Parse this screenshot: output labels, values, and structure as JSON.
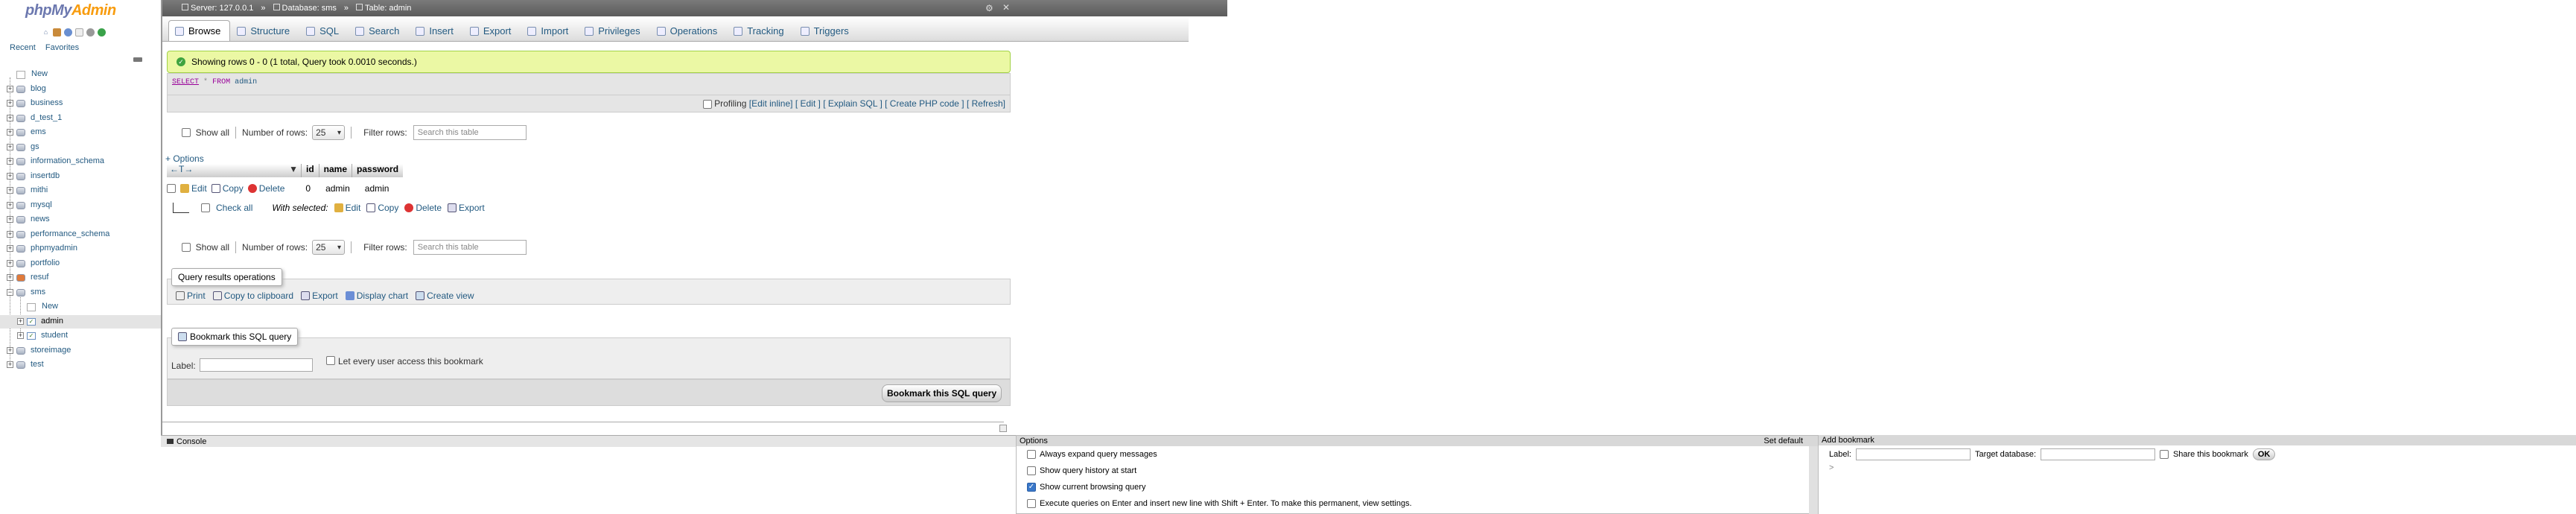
{
  "logo": {
    "php": "php",
    "my": "My",
    "admin": "Admin"
  },
  "nav": {
    "recent": "Recent",
    "favorites": "Favorites"
  },
  "tree": [
    {
      "label": "New",
      "kind": "new",
      "level": 0
    },
    {
      "label": "blog",
      "kind": "db",
      "level": 0
    },
    {
      "label": "business",
      "kind": "db",
      "level": 0
    },
    {
      "label": "d_test_1",
      "kind": "db",
      "level": 0
    },
    {
      "label": "ems",
      "kind": "db",
      "level": 0
    },
    {
      "label": "gs",
      "kind": "db",
      "level": 0
    },
    {
      "label": "information_schema",
      "kind": "db",
      "level": 0
    },
    {
      "label": "insertdb",
      "kind": "db",
      "level": 0
    },
    {
      "label": "mithi",
      "kind": "db",
      "level": 0
    },
    {
      "label": "mysql",
      "kind": "db",
      "level": 0
    },
    {
      "label": "news",
      "kind": "db",
      "level": 0
    },
    {
      "label": "performance_schema",
      "kind": "db",
      "level": 0
    },
    {
      "label": "phpmyadmin",
      "kind": "db",
      "level": 0
    },
    {
      "label": "portfolio",
      "kind": "db",
      "level": 0
    },
    {
      "label": "resuf",
      "kind": "db",
      "level": 0
    },
    {
      "label": "sms",
      "kind": "db",
      "level": 0
    },
    {
      "label": "New",
      "kind": "new",
      "level": 1
    },
    {
      "label": "admin",
      "kind": "table",
      "level": 1
    },
    {
      "label": "student",
      "kind": "table",
      "level": 1
    },
    {
      "label": "storeimage",
      "kind": "db",
      "level": 0
    },
    {
      "label": "test",
      "kind": "db",
      "level": 0
    }
  ],
  "breadcrumb": {
    "server": "Server: 127.0.0.1",
    "database": "Database: sms",
    "table": "Table: admin"
  },
  "tabs": [
    "Browse",
    "Structure",
    "SQL",
    "Search",
    "Insert",
    "Export",
    "Import",
    "Privileges",
    "Operations",
    "Tracking",
    "Triggers"
  ],
  "message": "Showing rows 0 - 0 (1 total, Query took 0.0010 seconds.)",
  "query": {
    "select": "SELECT",
    "star": "*",
    "from": "FROM",
    "table": "admin"
  },
  "profiling": {
    "label": "Profiling",
    "links": [
      "[Edit inline]",
      "[ Edit ]",
      "[ Explain SQL ]",
      "[ Create PHP code ]",
      "[ Refresh]"
    ]
  },
  "nav_rows": {
    "show_all": "Show all",
    "num_rows_label": "Number of rows:",
    "num_rows_value": "25",
    "filter_label": "Filter rows:",
    "filter_placeholder": "Search this table"
  },
  "options_link": "+ Options",
  "table": {
    "arrows": "←T→",
    "columns": [
      "id",
      "name",
      "password"
    ],
    "rows": [
      {
        "id": "0",
        "name": "admin",
        "password": "admin"
      }
    ]
  },
  "row_actions": {
    "edit": "Edit",
    "copy": "Copy",
    "delete": "Delete"
  },
  "with_selected": {
    "check_all": "Check all",
    "label": "With selected:",
    "edit": "Edit",
    "copy": "Copy",
    "delete": "Delete",
    "export": "Export"
  },
  "qro": {
    "legend": "Query results operations",
    "print": "Print",
    "clipboard": "Copy to clipboard",
    "export": "Export",
    "chart": "Display chart",
    "view": "Create view"
  },
  "bookmark_form": {
    "legend": "Bookmark this SQL query",
    "label": "Label:",
    "share": "Let every user access this bookmark",
    "button": "Bookmark this SQL query"
  },
  "console": {
    "label": "Console"
  },
  "options_panel": {
    "title": "Options",
    "set_default": "Set default",
    "items": [
      {
        "label": "Always expand query messages",
        "checked": false
      },
      {
        "label": "Show query history at start",
        "checked": false
      },
      {
        "label": "Show current browsing query",
        "checked": true
      },
      {
        "label": "Execute queries on Enter and insert new line with Shift + Enter. To make this permanent, view settings.",
        "checked": false
      }
    ]
  },
  "add_bookmark": {
    "title": "Add bookmark",
    "label": "Label:",
    "target": "Target database:",
    "share": "Share this bookmark",
    "ok": "OK",
    "prompt": ">"
  }
}
